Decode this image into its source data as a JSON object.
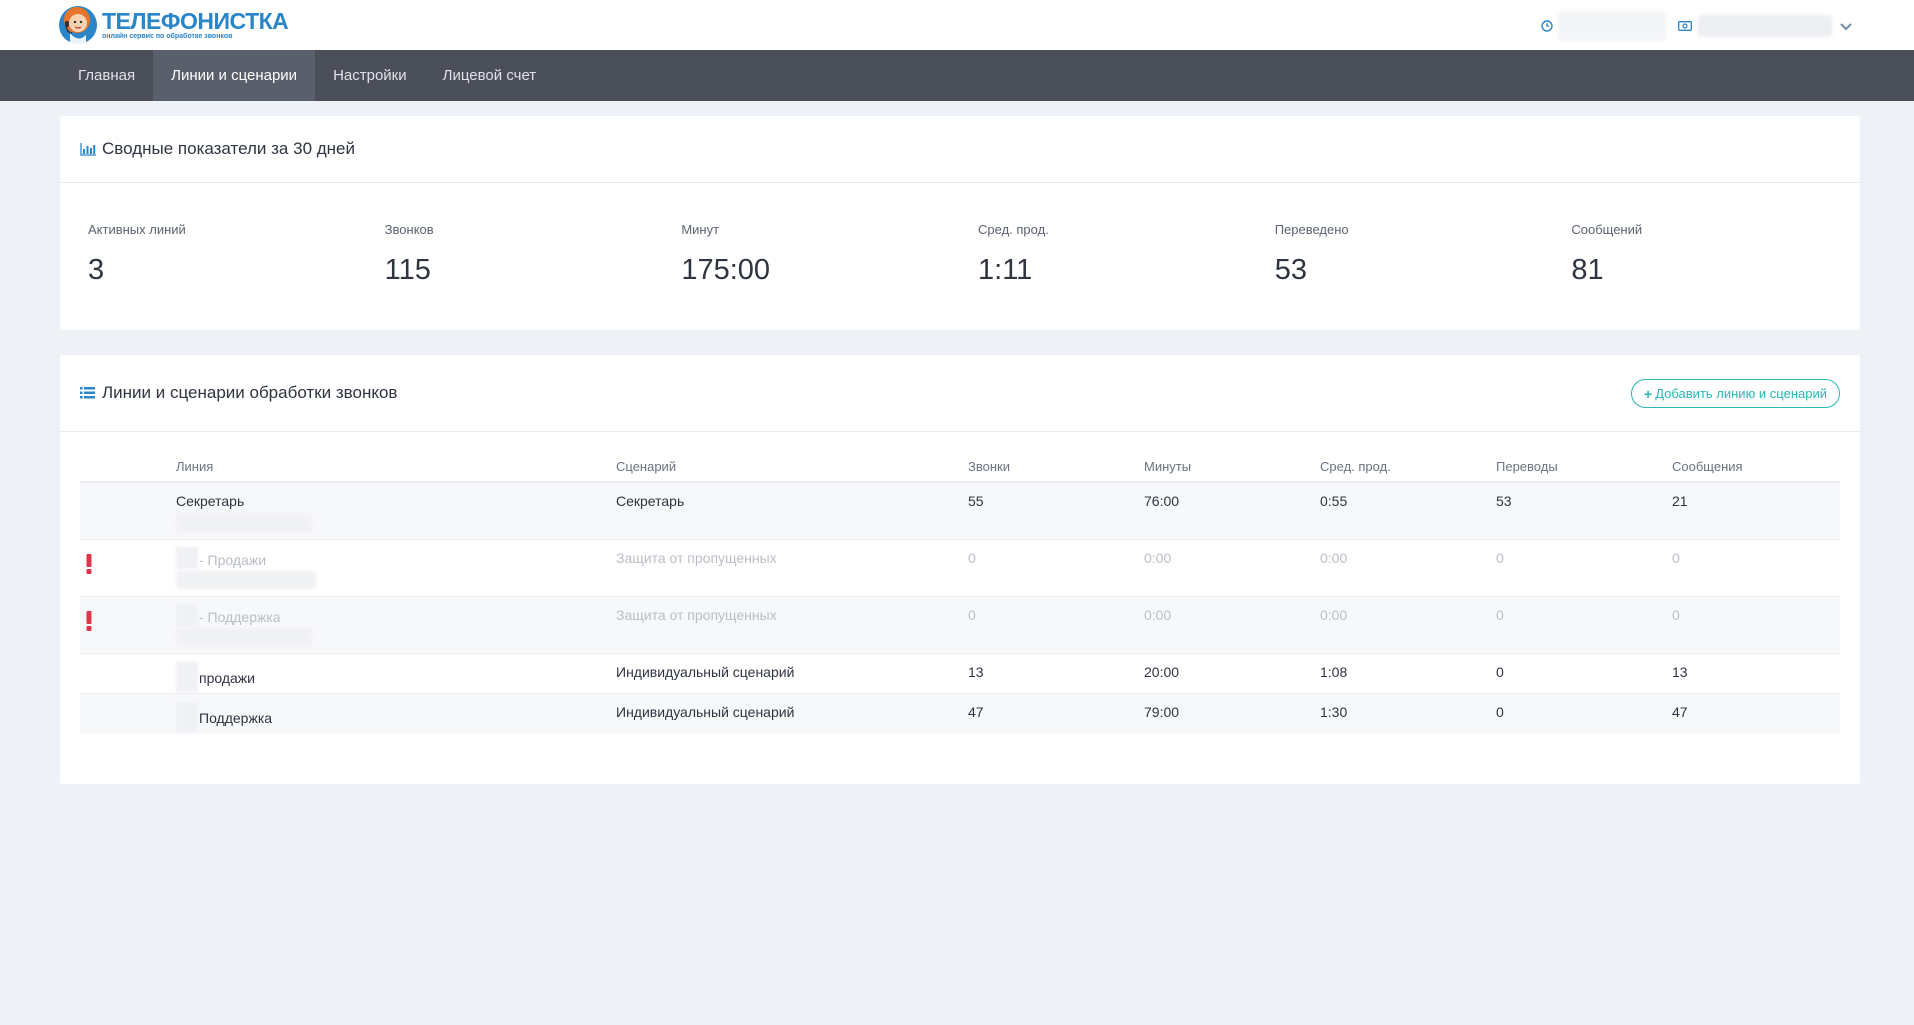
{
  "header": {
    "logo_title": "ТЕЛЕФОНИСТКА",
    "logo_subtitle": "онлайн сервис по обработке звонков",
    "brand_color": "#2a85c9",
    "icons": [
      "clock-icon",
      "cash-icon",
      "chevron-down-icon"
    ]
  },
  "nav": {
    "items": [
      {
        "label": "Главная",
        "active": false
      },
      {
        "label": "Линии и сценарии",
        "active": true
      },
      {
        "label": "Настройки",
        "active": false
      },
      {
        "label": "Лицевой счет",
        "active": false
      }
    ]
  },
  "summary": {
    "title": "Сводные показатели за 30 дней",
    "icon": "bar-chart-icon",
    "stats": [
      {
        "label": "Активных линий",
        "value": "3"
      },
      {
        "label": "Звонков",
        "value": "115"
      },
      {
        "label": "Минут",
        "value": "175:00"
      },
      {
        "label": "Сред. прод.",
        "value": "1:11"
      },
      {
        "label": "Переведено",
        "value": "53"
      },
      {
        "label": "Сообщений",
        "value": "81"
      }
    ]
  },
  "lines": {
    "title": "Линии и сценарии обработки звонков",
    "icon": "list-icon",
    "add_button": "Добавить линию и сценарий",
    "accent_color": "#2bb5b5",
    "warning_color": "#e0344a",
    "columns": [
      "Линия",
      "Сценарий",
      "Звонки",
      "Минуты",
      "Сред. прод.",
      "Переводы",
      "Сообщения"
    ],
    "rows": [
      {
        "line": "Секретарь",
        "scenario": "Секретарь",
        "calls": "55",
        "minutes": "76:00",
        "avg": "0:55",
        "transfers": "53",
        "messages": "21",
        "warning": false,
        "muted": false
      },
      {
        "line": "- Продажи",
        "scenario": "Защита от пропущенных",
        "calls": "0",
        "minutes": "0:00",
        "avg": "0:00",
        "transfers": "0",
        "messages": "0",
        "warning": true,
        "muted": true
      },
      {
        "line": "- Поддержка",
        "scenario": "Защита от пропущенных",
        "calls": "0",
        "minutes": "0:00",
        "avg": "0:00",
        "transfers": "0",
        "messages": "0",
        "warning": true,
        "muted": true
      },
      {
        "line": "продажи",
        "scenario": "Индивидуальный сценарий",
        "calls": "13",
        "minutes": "20:00",
        "avg": "1:08",
        "transfers": "0",
        "messages": "13",
        "warning": false,
        "muted": false
      },
      {
        "line": "Поддержка",
        "scenario": "Индивидуальный сценарий",
        "calls": "47",
        "minutes": "79:00",
        "avg": "1:30",
        "transfers": "0",
        "messages": "47",
        "warning": false,
        "muted": false
      }
    ]
  }
}
